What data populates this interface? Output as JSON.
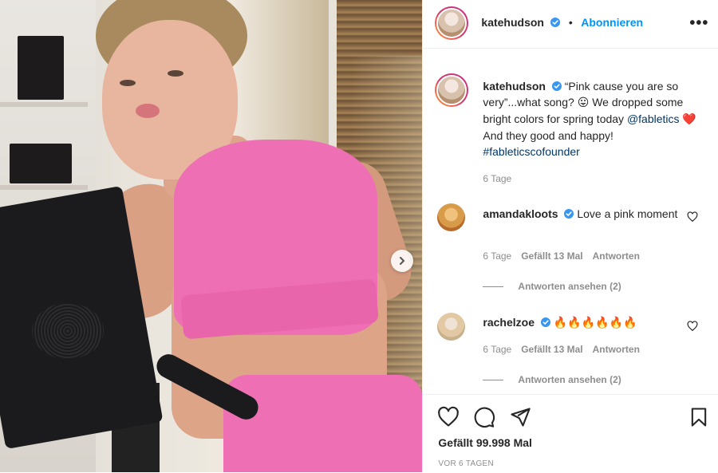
{
  "post": {
    "author": "katehudson",
    "follow_label": "Abonnieren",
    "more_label": "•••",
    "caption": {
      "username": "katehudson",
      "text_part1": "“Pink cause you are so very”...what song?",
      "emoji1": "😛",
      "text_part2": "We dropped some bright colors for spring today",
      "mention": "@fabletics",
      "emoji2": "❤️",
      "text_part3": "And they good and happy!",
      "hashtag": "#fableticscofounder",
      "time": "6 Tage"
    },
    "comments": [
      {
        "username": "amandakloots",
        "text": "Love a pink moment",
        "time": "6 Tage",
        "likes": "Gefällt 13 Mal",
        "reply": "Antworten",
        "view_replies": "Antworten ansehen (2)"
      },
      {
        "username": "rachelzoe",
        "text": "🔥🔥🔥🔥🔥🔥",
        "time": "6 Tage",
        "likes": "Gefällt 13 Mal",
        "reply": "Antworten",
        "view_replies": "Antworten ansehen (2)"
      }
    ],
    "likes_count": "Gefällt 99.998 Mal",
    "posted_ago": "VOR 6 TAGEN"
  },
  "colors": {
    "accent": "#0095f6",
    "verified": "#3897f0",
    "link": "#00376b",
    "muted": "#8e8e8e",
    "bra_pink": "#ee6fb4"
  },
  "icons": [
    "verified-badge-icon",
    "more-options-icon",
    "heart-icon",
    "comment-icon",
    "share-icon",
    "bookmark-icon",
    "chevron-right-icon"
  ]
}
